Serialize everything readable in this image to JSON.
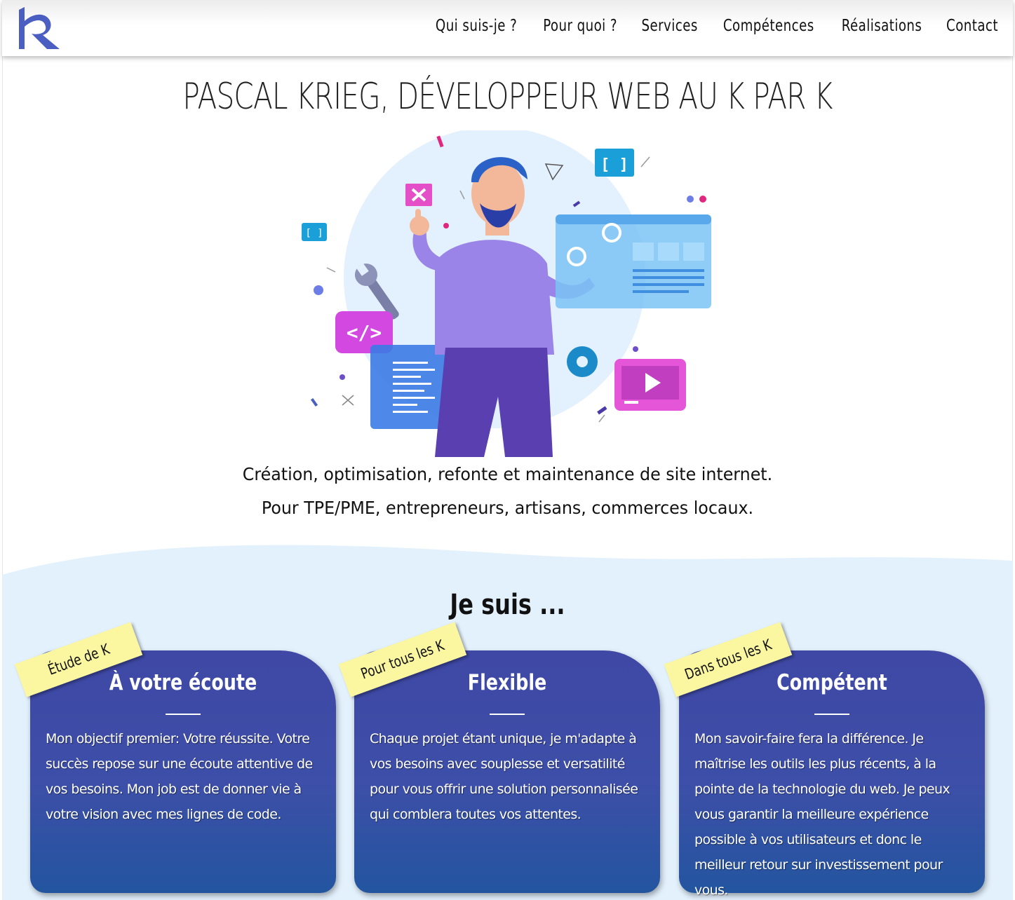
{
  "header": {
    "logo_letter": "k",
    "nav": [
      {
        "label": "Qui suis-je ?"
      },
      {
        "label": "Pour quoi ?"
      },
      {
        "label": "Services"
      },
      {
        "label": "Compétences"
      },
      {
        "label": "Réalisations"
      },
      {
        "label": "Contact"
      }
    ]
  },
  "hero": {
    "title": "PASCAL KRIEG, DÉVELOPPEUR WEB AU K PAR K",
    "line1": "Création, optimisation, refonte et maintenance de site internet.",
    "line2": "Pour TPE/PME, entrepreneurs, artisans, commerces locaux.",
    "illustration_icons": [
      "close-icon",
      "code-brackets-icon",
      "code-tag-icon",
      "wrench-icon",
      "gear-icon",
      "video-play-icon",
      "browser-window-icon"
    ],
    "code_tag_text": "</>",
    "bracket_text": "[ ]"
  },
  "section": {
    "title": "Je suis ..."
  },
  "cards": [
    {
      "ribbon": "Étude de K",
      "title": "À votre écoute",
      "text": "Mon objectif premier: Votre réussite. Votre succès repose sur une écoute attentive de vos besoins. Mon job est de donner vie à votre vision avec mes lignes de code."
    },
    {
      "ribbon": "Pour tous les K",
      "title": "Flexible",
      "text": "Chaque projet étant unique, je m'adapte à vos besoins avec souplesse et versatilité pour vous offrir une solution personnalisée qui comblera toutes vos attentes."
    },
    {
      "ribbon": "Dans tous les K",
      "title": "Compétent",
      "text": "Mon savoir-faire fera la différence. Je maîtrise les outils les plus récents, à la pointe de la technologie du web. Je peux vous garantir la meilleure expérience possible à vos utilisateurs et donc le meilleur retour sur investissement pour vous."
    }
  ],
  "colors": {
    "brand": "#4a5fc1",
    "card_top": "#3f48a5",
    "card_bottom": "#23559f",
    "ribbon": "#fbf7a0",
    "wave_bg": "#e3f1fd"
  }
}
